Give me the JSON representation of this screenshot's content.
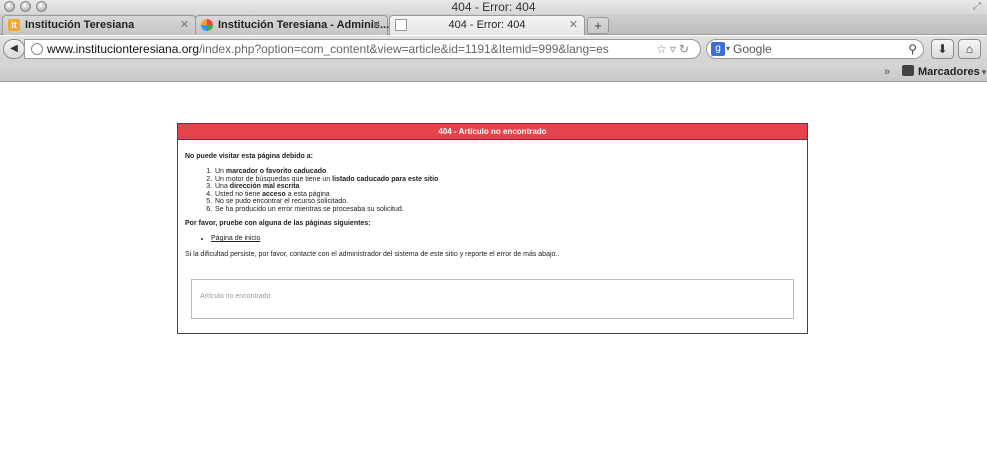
{
  "window": {
    "title": "404 - Error: 404"
  },
  "tabs": [
    {
      "label": "Institución Teresiana",
      "favicon": "institution-logo"
    },
    {
      "label": "Institución Teresiana - Adminis...",
      "favicon": "joomla-logo"
    },
    {
      "label": "404 - Error: 404",
      "favicon": "blank-page"
    }
  ],
  "toolbar": {
    "url_host": "www.institucionteresiana.org",
    "url_path": "/index.php?option=com_content&view=article&id=1191&Itemid=999&lang=es",
    "search_engine": "Google",
    "search_placeholder": "Google"
  },
  "bookmarks": {
    "overflow": "»",
    "folder_label": "Marcadores"
  },
  "error_page": {
    "header": "404 - Artículo no encontrado",
    "header_color": "#e5434d",
    "intro": "No puede visitar esta página debido a:",
    "reasons": [
      {
        "before": "Un ",
        "bold": "marcador o favorito caducado",
        "after": ""
      },
      {
        "before": "Un motor de búsquedas que tiene un ",
        "bold": "listado caducado para este sitio",
        "after": ""
      },
      {
        "before": "Una ",
        "bold": "dirección mal escrita",
        "after": ""
      },
      {
        "before": "Usted no tiene ",
        "bold": "acceso",
        "after": " a esta página"
      },
      {
        "before": "No se pudo encontrar el recurso solicitado.",
        "bold": "",
        "after": ""
      },
      {
        "before": "Se ha producido un error mientras se procesaba su solicitud.",
        "bold": "",
        "after": ""
      }
    ],
    "try_text": "Por favor, pruebe con alguna de las páginas siguientes:",
    "home_link": "Página de inicio",
    "contact_text": "Si la dificultad persiste, por favor, contacte con el administrador del sistema de este sitio y reporte el error de más abajo..",
    "error_message": "Artículo no encontrado"
  }
}
